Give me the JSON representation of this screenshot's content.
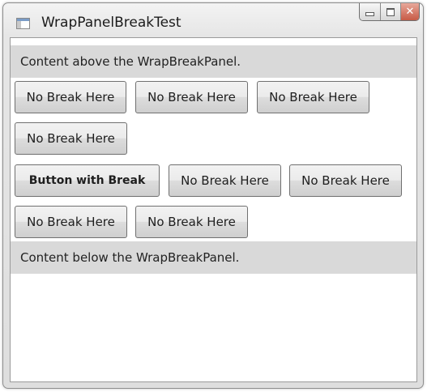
{
  "window": {
    "title": "WrapPanelBreakTest",
    "app_icon": "window-app-icon",
    "caption_buttons": {
      "minimize_icon": "minimize-icon",
      "maximize_icon": "maximize-icon",
      "close_icon": "close-icon",
      "close_glyph": "✕"
    }
  },
  "content": {
    "above_text": "Content above the WrapBreakPanel.",
    "below_text": "Content below the WrapBreakPanel.",
    "buttons": [
      "No Break Here",
      "No Break Here",
      "No Break Here",
      "No Break Here",
      "Button with Break",
      "No Break Here",
      "No Break Here",
      "No Break Here",
      "No Break Here"
    ]
  }
}
